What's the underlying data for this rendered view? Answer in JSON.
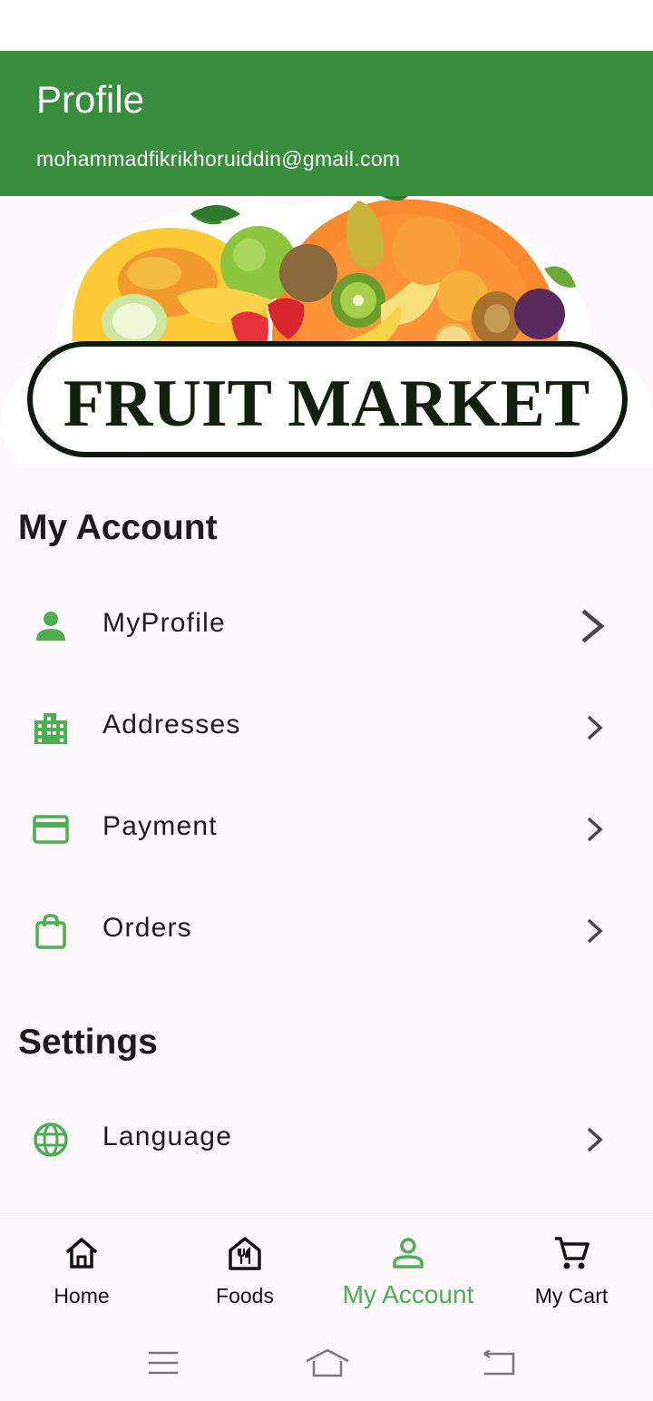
{
  "header": {
    "title": "Profile",
    "email": "mohammadfikrikhoruiddin@gmail.com"
  },
  "banner": {
    "text": "FRUIT MARKET"
  },
  "sections": {
    "account": {
      "title": "My Account",
      "items": [
        {
          "label": "MyProfile",
          "icon": "person-icon"
        },
        {
          "label": "Addresses",
          "icon": "building-icon"
        },
        {
          "label": "Payment",
          "icon": "credit-card-icon"
        },
        {
          "label": "Orders",
          "icon": "shopping-bag-icon"
        }
      ]
    },
    "settings": {
      "title": "Settings",
      "items": [
        {
          "label": "Language",
          "icon": "globe-icon"
        }
      ]
    }
  },
  "bottom_nav": {
    "items": [
      {
        "label": "Home",
        "icon": "home-icon"
      },
      {
        "label": "Foods",
        "icon": "restaurant-icon"
      },
      {
        "label": "My Account",
        "icon": "account-icon"
      },
      {
        "label": "My Cart",
        "icon": "cart-icon"
      }
    ],
    "active": "My Account"
  },
  "colors": {
    "primary": "#388e3c",
    "icon_green": "#4caf50",
    "background": "#fdf8fc"
  }
}
